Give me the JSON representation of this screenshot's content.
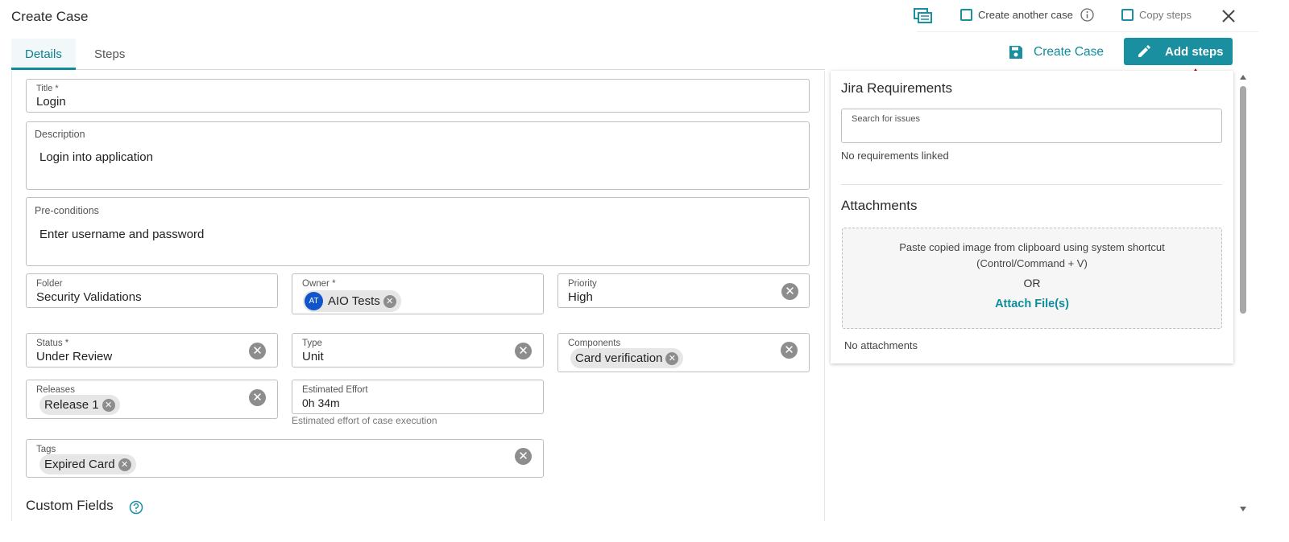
{
  "header": {
    "title": "Create Case",
    "create_another_label": "Create another case",
    "copy_steps_label": "Copy steps"
  },
  "tabs": [
    {
      "label": "Details",
      "active": true
    },
    {
      "label": "Steps",
      "active": false
    }
  ],
  "actions": {
    "create_case_label": "Create Case",
    "add_steps_label": "Add steps"
  },
  "form": {
    "title": {
      "label": "Title *",
      "value": "Login"
    },
    "description": {
      "label": "Description",
      "value": "Login into application"
    },
    "preconditions": {
      "label": "Pre-conditions",
      "value": "Enter username and password"
    },
    "folder": {
      "label": "Folder",
      "value": "Security Validations"
    },
    "owner": {
      "label": "Owner *",
      "initials": "AT",
      "value": "AIO Tests"
    },
    "priority": {
      "label": "Priority",
      "value": "High"
    },
    "status": {
      "label": "Status *",
      "value": "Under Review"
    },
    "type": {
      "label": "Type",
      "value": "Unit"
    },
    "components": {
      "label": "Components",
      "value": "Card verification"
    },
    "releases": {
      "label": "Releases",
      "value": "Release 1"
    },
    "estimated_effort": {
      "label": "Estimated Effort",
      "value": "0h 34m",
      "help": "Estimated effort of case execution"
    },
    "tags": {
      "label": "Tags",
      "value": "Expired Card"
    },
    "custom_fields_title": "Custom Fields"
  },
  "jira": {
    "title": "Jira Requirements",
    "search_placeholder": "Search for issues",
    "empty_text": "No requirements linked"
  },
  "attachments": {
    "title": "Attachments",
    "paste_hint_line1": "Paste copied image from clipboard using system shortcut",
    "paste_hint_line2": "(Control/Command + V)",
    "or_text": "OR",
    "attach_link": "Attach File(s)",
    "empty_text": "No attachments"
  },
  "colors": {
    "accent": "#1a8fa0",
    "avatar": "#1155cc",
    "arrow": "#e00000"
  },
  "icons": [
    "comments-icon",
    "info-icon",
    "close-icon",
    "save-icon",
    "pencil-icon",
    "help-icon",
    "clear-icon",
    "chevron-up-icon",
    "chevron-down-icon"
  ]
}
